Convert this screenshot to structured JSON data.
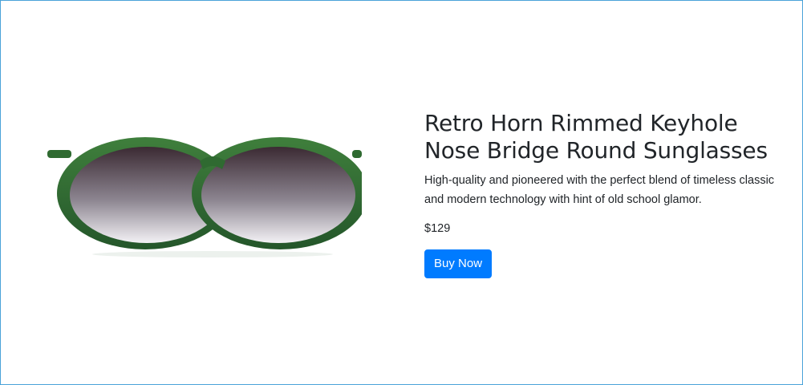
{
  "product": {
    "title": "Retro Horn Rimmed Keyhole Nose Bridge Round Sunglasses",
    "description": "High-quality and pioneered with the perfect blend of timeless classic and modern technology with hint of old school glamor.",
    "price": "$129",
    "buy_label": "Buy Now",
    "image_icon": "sunglasses-image"
  },
  "colors": {
    "accent": "#007bff",
    "frame_green": "#2e6b2f",
    "lens_dark": "#3a2f35",
    "text": "#212529",
    "border": "#4aa3d9"
  }
}
